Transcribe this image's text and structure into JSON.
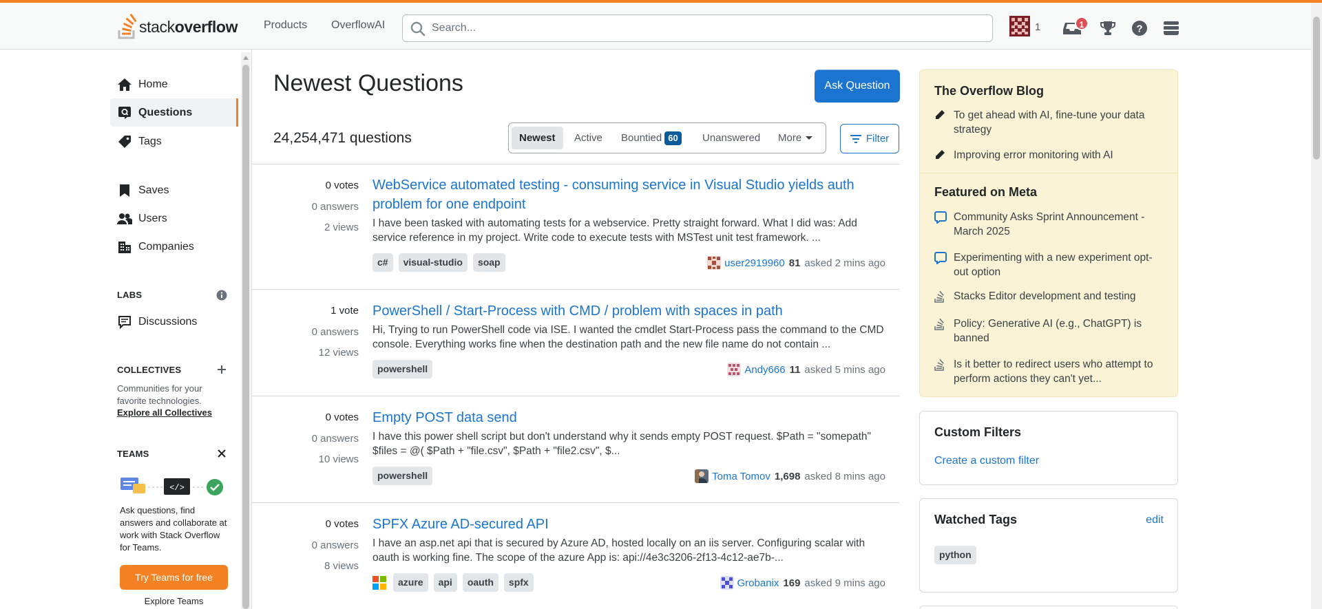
{
  "header": {
    "logo_text_regular": "stack",
    "logo_text_bold": "overflow",
    "nav": [
      "Products",
      "OverflowAI"
    ],
    "search_placeholder": "Search...",
    "reputation": "1",
    "inbox_badge": "1"
  },
  "sidebar": {
    "items": [
      {
        "label": "Home",
        "icon": "home-icon"
      },
      {
        "label": "Questions",
        "icon": "questions-icon",
        "active": true
      },
      {
        "label": "Tags",
        "icon": "tag-icon"
      },
      {
        "label": "Saves",
        "icon": "bookmark-icon"
      },
      {
        "label": "Users",
        "icon": "users-icon"
      },
      {
        "label": "Companies",
        "icon": "companies-icon"
      }
    ],
    "labs_title": "LABS",
    "discussions_label": "Discussions",
    "collectives_title": "COLLECTIVES",
    "collectives_text": "Communities for your favorite technologies.",
    "collectives_link": "Explore all Collectives",
    "teams_title": "TEAMS",
    "teams_text": "Ask questions, find answers and collaborate at work with Stack Overflow for Teams.",
    "teams_button": "Try Teams for free",
    "teams_explore": "Explore Teams"
  },
  "main": {
    "title": "Newest Questions",
    "ask_button": "Ask Question",
    "question_count": "24,254,471 questions",
    "tabs": {
      "newest": "Newest",
      "active": "Active",
      "bountied": "Bountied",
      "bountied_count": "60",
      "unanswered": "Unanswered",
      "more": "More"
    },
    "filter_button": "Filter",
    "questions": [
      {
        "votes": "0 votes",
        "answers": "0 answers",
        "views": "2 views",
        "title": "WebService automated testing - consuming service in Visual Studio yields auth problem for one endpoint",
        "excerpt": "I have been tasked with automating tests for a webservice. Pretty straight forward. What I did was: Add service reference in my project. Write code to execute tests with MSTest unit test framework. ...",
        "tags": [
          "c#",
          "visual-studio",
          "soap"
        ],
        "user": "user2919960",
        "rep": "81",
        "time": "asked 2 mins ago"
      },
      {
        "votes": "1 vote",
        "answers": "0 answers",
        "views": "12 views",
        "title": "PowerShell / Start-Process with CMD / problem with spaces in path",
        "excerpt": "Hi, Trying to run PowerShell code via ISE. I wanted the cmdlet Start-Process pass the command to the CMD console. Everything works fine when the destination path and the new file name do not contain ...",
        "tags": [
          "powershell"
        ],
        "user": "Andy666",
        "rep": "11",
        "time": "asked 5 mins ago"
      },
      {
        "votes": "0 votes",
        "answers": "0 answers",
        "views": "10 views",
        "title": "Empty POST data send",
        "excerpt": "I have this power shell script but don't understand why it sends empty POST request. $Path = \"somepath\" $files = @( $Path + \"file.csv\", $Path + \"file2.csv\", $...",
        "tags": [
          "powershell"
        ],
        "user": "Toma Tomov",
        "rep": "1,698",
        "time": "asked 8 mins ago"
      },
      {
        "votes": "0 votes",
        "answers": "0 answers",
        "views": "8 views",
        "title": "SPFX Azure AD-secured API",
        "excerpt": "I have an asp.net api that is secured by Azure AD, hosted locally on an iis server. Configuring scalar with oauth is working fine. The scope of the azure App is: api://4e3c3206-2f13-4c12-ae7b-...",
        "tags": [
          "azure",
          "api",
          "oauth",
          "spfx"
        ],
        "user": "Grobanix",
        "rep": "169",
        "time": "asked 9 mins ago"
      }
    ]
  },
  "right": {
    "blog_title": "The Overflow Blog",
    "blog_items": [
      "To get ahead with AI, fine-tune your data strategy",
      "Improving error monitoring with AI"
    ],
    "meta_title": "Featured on Meta",
    "meta_items": [
      {
        "text": "Community Asks Sprint Announcement - March 2025",
        "icon": "chat-bubble-icon"
      },
      {
        "text": "Experimenting with a new experiment opt-out option",
        "icon": "chat-bubble-icon"
      },
      {
        "text": "Stacks Editor development and testing",
        "icon": "stack-logo-icon"
      },
      {
        "text": "Policy: Generative AI (e.g., ChatGPT) is banned",
        "icon": "stack-logo-icon"
      },
      {
        "text": "Is it better to redirect users who attempt to perform actions they can't yet...",
        "icon": "stack-logo-icon"
      }
    ],
    "custom_filters_title": "Custom Filters",
    "custom_filters_link": "Create a custom filter",
    "watched_tags_title": "Watched Tags",
    "watched_tags_edit": "edit",
    "watched_tags": [
      "python"
    ]
  },
  "colors": {
    "accent_orange": "#f48225",
    "link_blue": "#1b75d0",
    "blog_bg": "#fbf3d5",
    "badge_red": "#de4f54"
  }
}
